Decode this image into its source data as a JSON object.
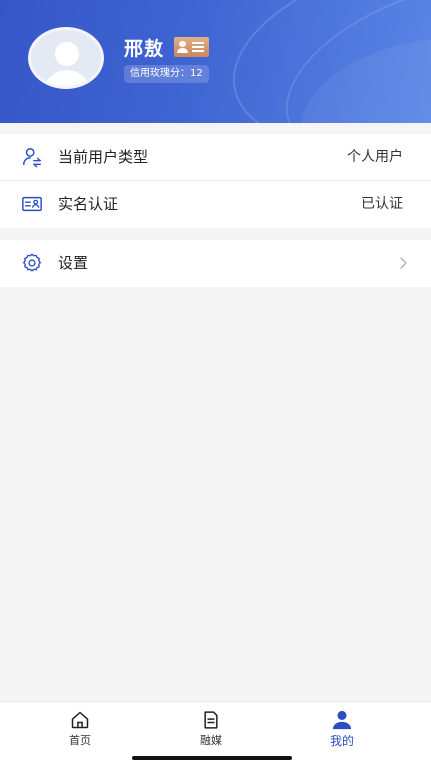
{
  "profile": {
    "name": "邢敖",
    "credit_score_text": "信用玫瑰分：12"
  },
  "account_card": {
    "items": [
      {
        "label": "当前用户类型",
        "value": "个人用户",
        "icon": "user-switch-icon"
      },
      {
        "label": "实名认证",
        "value": "已认证",
        "icon": "id-card-icon"
      }
    ]
  },
  "settings_card": {
    "items": [
      {
        "label": "设置",
        "icon": "gear-icon"
      }
    ]
  },
  "tabbar": {
    "tabs": [
      {
        "label": "首页",
        "icon": "home-icon",
        "active": false
      },
      {
        "label": "融媒",
        "icon": "document-icon",
        "active": false
      },
      {
        "label": "我的",
        "icon": "person-icon",
        "active": true
      }
    ]
  },
  "colors": {
    "primary": "#2b4fc3",
    "header_gradient_start": "#3656c8",
    "header_gradient_end": "#5a86e6",
    "badge": "#d09a6c"
  }
}
